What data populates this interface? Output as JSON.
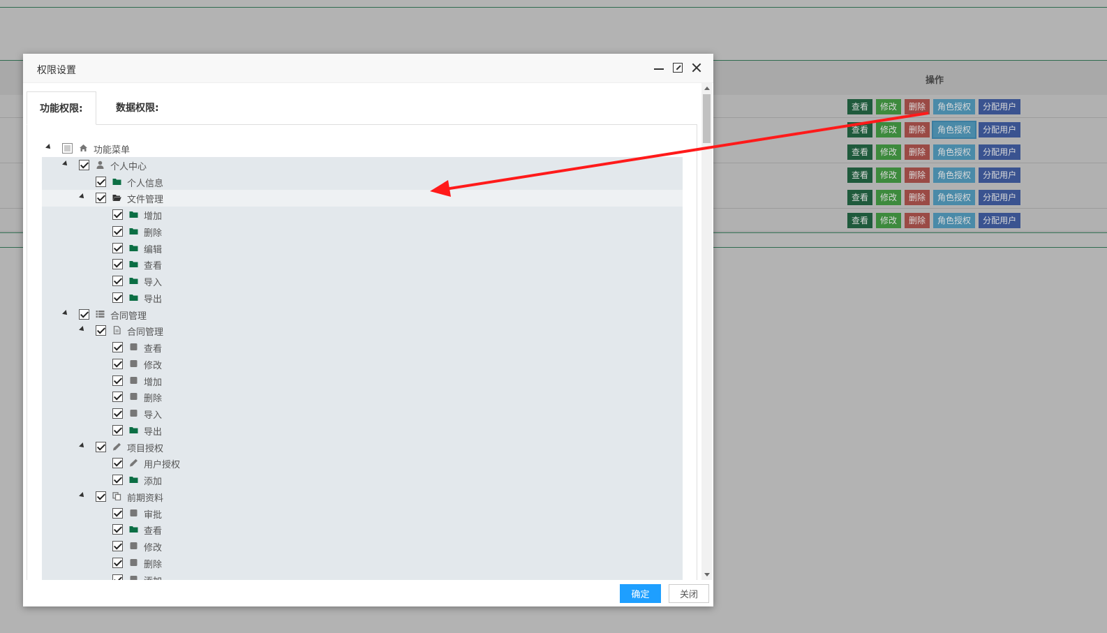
{
  "background": {
    "operation_header": "操作",
    "row_buttons": {
      "view": "查看",
      "edit": "修改",
      "delete": "删除",
      "role_auth": "角色授权",
      "assign_users": "分配用户"
    },
    "row_count": 6
  },
  "modal": {
    "title": "权限设置",
    "tabs": [
      {
        "label": "功能权限:"
      },
      {
        "label": "数据权限:"
      }
    ],
    "tree": [
      {
        "label": "功能菜单",
        "level": 0,
        "expander": true,
        "state": "partial",
        "icon": "home-icon",
        "bg": "none"
      },
      {
        "label": "个人中心",
        "level": 1,
        "expander": true,
        "state": "checked",
        "icon": "user-icon",
        "bg": "sel"
      },
      {
        "label": "个人信息",
        "level": 2,
        "expander": false,
        "state": "checked",
        "icon": "folder-icon",
        "bg": "sel"
      },
      {
        "label": "文件管理",
        "level": 2,
        "expander": true,
        "state": "checked",
        "icon": "folder-open-icon",
        "bg": "hl"
      },
      {
        "label": "增加",
        "level": 3,
        "expander": false,
        "state": "checked",
        "icon": "folder-icon",
        "bg": "sel"
      },
      {
        "label": "删除",
        "level": 3,
        "expander": false,
        "state": "checked",
        "icon": "folder-icon",
        "bg": "sel"
      },
      {
        "label": "编辑",
        "level": 3,
        "expander": false,
        "state": "checked",
        "icon": "folder-icon",
        "bg": "sel"
      },
      {
        "label": "查看",
        "level": 3,
        "expander": false,
        "state": "checked",
        "icon": "folder-icon",
        "bg": "sel"
      },
      {
        "label": "导入",
        "level": 3,
        "expander": false,
        "state": "checked",
        "icon": "folder-icon",
        "bg": "sel"
      },
      {
        "label": "导出",
        "level": 3,
        "expander": false,
        "state": "checked",
        "icon": "folder-icon",
        "bg": "sel"
      },
      {
        "label": "合同管理",
        "level": 1,
        "expander": true,
        "state": "checked",
        "icon": "list-icon",
        "bg": "sel"
      },
      {
        "label": "合同管理",
        "level": 2,
        "expander": true,
        "state": "checked",
        "icon": "document-icon",
        "bg": "sel"
      },
      {
        "label": "查看",
        "level": 3,
        "expander": false,
        "state": "checked",
        "icon": "square-icon",
        "bg": "sel"
      },
      {
        "label": "修改",
        "level": 3,
        "expander": false,
        "state": "checked",
        "icon": "square-icon",
        "bg": "sel"
      },
      {
        "label": "增加",
        "level": 3,
        "expander": false,
        "state": "checked",
        "icon": "square-icon",
        "bg": "sel"
      },
      {
        "label": "删除",
        "level": 3,
        "expander": false,
        "state": "checked",
        "icon": "square-icon",
        "bg": "sel"
      },
      {
        "label": "导入",
        "level": 3,
        "expander": false,
        "state": "checked",
        "icon": "square-icon",
        "bg": "sel"
      },
      {
        "label": "导出",
        "level": 3,
        "expander": false,
        "state": "checked",
        "icon": "folder-icon",
        "bg": "sel"
      },
      {
        "label": "项目授权",
        "level": 2,
        "expander": true,
        "state": "checked",
        "icon": "pencil-icon",
        "bg": "sel"
      },
      {
        "label": "用户授权",
        "level": 3,
        "expander": false,
        "state": "checked",
        "icon": "pencil-icon",
        "bg": "sel"
      },
      {
        "label": "添加",
        "level": 3,
        "expander": false,
        "state": "checked",
        "icon": "folder-icon",
        "bg": "sel"
      },
      {
        "label": "前期资料",
        "level": 2,
        "expander": true,
        "state": "checked",
        "icon": "copy-icon",
        "bg": "sel"
      },
      {
        "label": "审批",
        "level": 3,
        "expander": false,
        "state": "checked",
        "icon": "square-icon",
        "bg": "sel"
      },
      {
        "label": "查看",
        "level": 3,
        "expander": false,
        "state": "checked",
        "icon": "folder-icon",
        "bg": "sel"
      },
      {
        "label": "修改",
        "level": 3,
        "expander": false,
        "state": "checked",
        "icon": "square-icon",
        "bg": "sel"
      },
      {
        "label": "删除",
        "level": 3,
        "expander": false,
        "state": "checked",
        "icon": "square-icon",
        "bg": "sel"
      },
      {
        "label": "添加",
        "level": 3,
        "expander": false,
        "state": "checked",
        "icon": "square-icon",
        "bg": "sel"
      }
    ],
    "footer": {
      "ok": "确定",
      "close": "关闭"
    }
  },
  "colors": {
    "folder_green": "#0b6e44",
    "icon_gray": "#777777",
    "primary_button": "#1e9fff",
    "annotation_arrow": "#ff1a1a"
  }
}
